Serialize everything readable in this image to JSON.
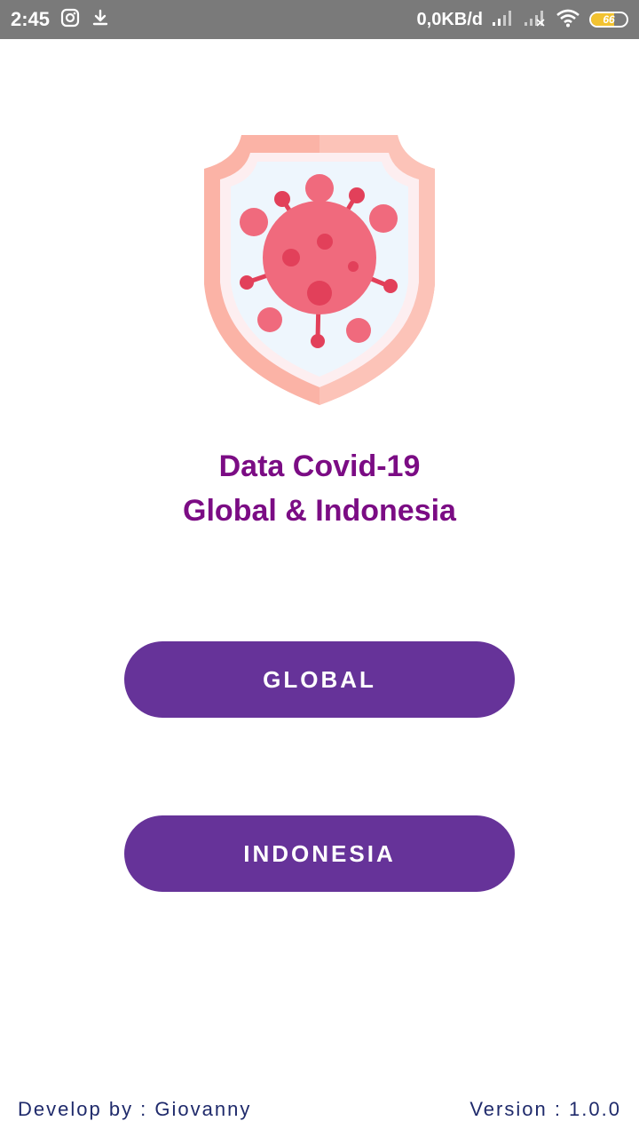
{
  "status_bar": {
    "time": "2:45",
    "speed": "0,0KB/d",
    "battery_level": "66",
    "battery_fraction": 0.66,
    "left_icons": [
      "instagram-icon",
      "download-icon"
    ],
    "right_icons": [
      "signal-icon",
      "signal-off-icon",
      "wifi-icon",
      "battery-icon"
    ]
  },
  "app": {
    "logo_icon": "virus-shield-icon",
    "title_line1": "Data Covid-19",
    "title_line2": "Global & Indonesia"
  },
  "buttons": {
    "global_label": "GLOBAL",
    "indonesia_label": "INDONESIA"
  },
  "footer": {
    "developer": "Develop by : Giovanny",
    "version": "Version : 1.0.0"
  },
  "colors": {
    "title": "#7b0c84",
    "button": "#663399",
    "footer_text": "#1f2a6b",
    "status_bar": "#7a7a7a"
  }
}
